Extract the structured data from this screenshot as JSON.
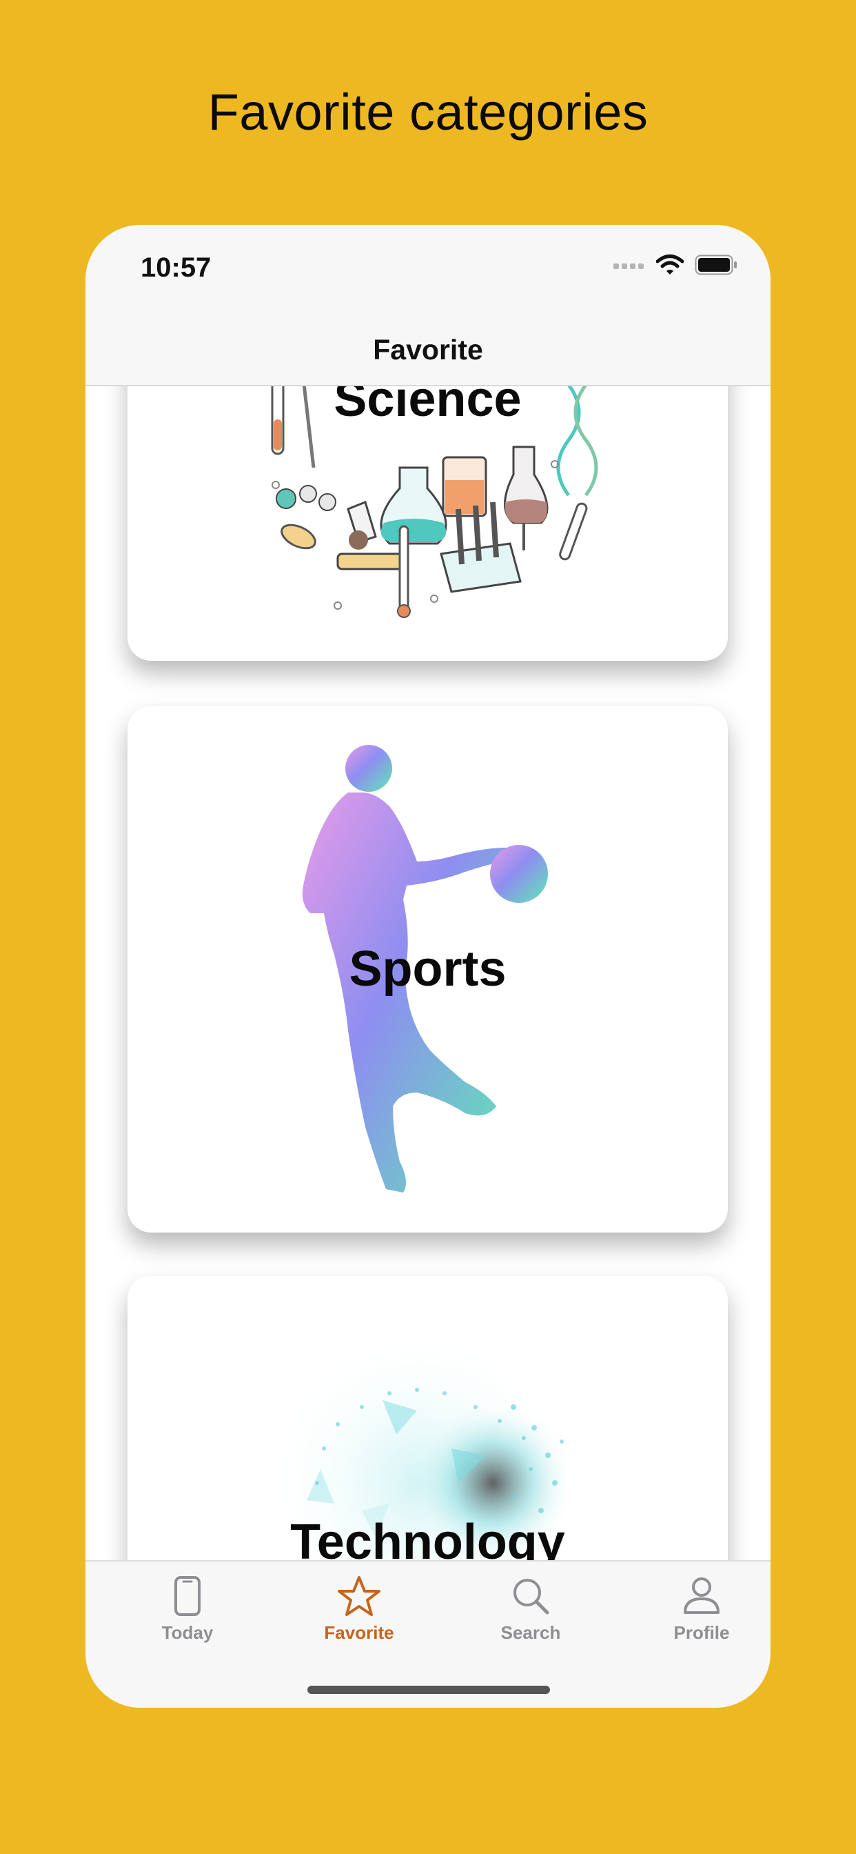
{
  "headline": "Favorite categories",
  "status_bar": {
    "time": "10:57"
  },
  "nav": {
    "title": "Favorite"
  },
  "cards": [
    {
      "label": "Science",
      "art": "science-illustration"
    },
    {
      "label": "Sports",
      "art": "basketball-player-silhouette"
    },
    {
      "label": "Technology",
      "art": "network-globe"
    }
  ],
  "tabs": [
    {
      "label": "Today",
      "icon": "phone-icon",
      "active": false
    },
    {
      "label": "Favorite",
      "icon": "star-icon",
      "active": true
    },
    {
      "label": "Search",
      "icon": "search-icon",
      "active": false
    },
    {
      "label": "Profile",
      "icon": "person-icon",
      "active": false
    }
  ],
  "colors": {
    "background": "#EDB822",
    "tab_active": "#C7641C",
    "tab_inactive": "#8E8E93"
  }
}
